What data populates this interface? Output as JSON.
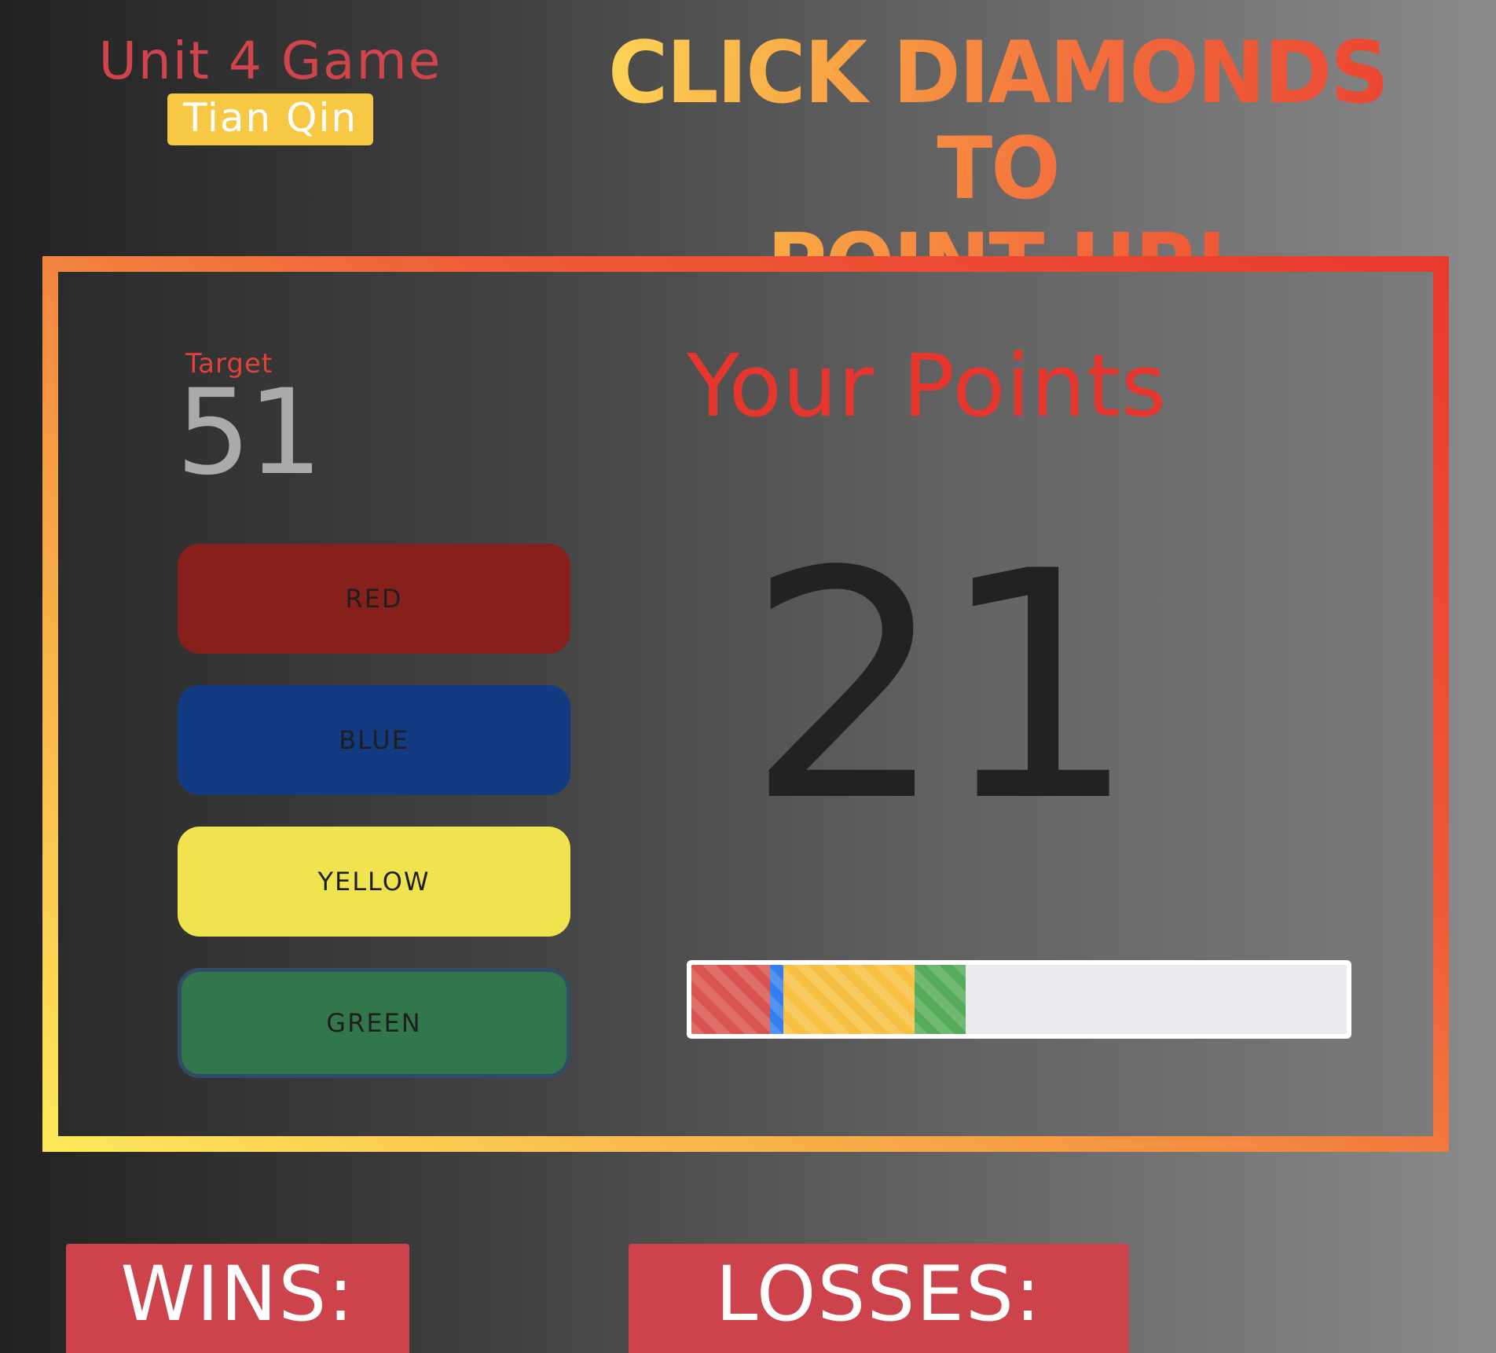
{
  "header": {
    "app_title": "Unit 4 Game",
    "author": "Tian Qin",
    "headline_line1": "CLICK DIAMONDS TO",
    "headline_line2": "POINT UP!"
  },
  "game": {
    "target_label": "Target",
    "target_value": "51",
    "points_label": "Your Points",
    "points_value": "21",
    "buttons": [
      {
        "label": "RED",
        "color": "#85201b"
      },
      {
        "label": "BLUE",
        "color": "#133b81"
      },
      {
        "label": "YELLOW",
        "color": "#efe34f"
      },
      {
        "label": "GREEN",
        "color": "#32774b"
      }
    ],
    "progress": {
      "segments": [
        {
          "color": "red",
          "fill_color": "#d9534f",
          "value": 0.12
        },
        {
          "color": "blue",
          "fill_color": "#337ef0",
          "value": 0.02
        },
        {
          "color": "yellow",
          "fill_color": "#f7c042",
          "value": 0.2
        },
        {
          "color": "green",
          "fill_color": "#55ab5a",
          "value": 0.078
        }
      ]
    }
  },
  "scoreboard": {
    "wins_label": "WINS:",
    "losses_label": "LOSSES:"
  },
  "theme": {
    "accent_red": "#d0444c",
    "badge_yellow": "#f7c843",
    "points_red": "#e7362e"
  }
}
